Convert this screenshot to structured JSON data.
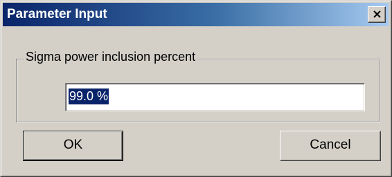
{
  "window": {
    "title": "Parameter Input"
  },
  "group": {
    "legend": "Sigma power inclusion percent"
  },
  "field": {
    "value": "99.0 %"
  },
  "buttons": {
    "ok_label": "OK",
    "cancel_label": "Cancel"
  },
  "colors": {
    "titlebar_start": "#0a246a",
    "titlebar_end": "#a6caf0",
    "dialog_face": "#d4d0c8",
    "selection": "#0a246a"
  },
  "icons": {
    "close": "close-icon"
  }
}
